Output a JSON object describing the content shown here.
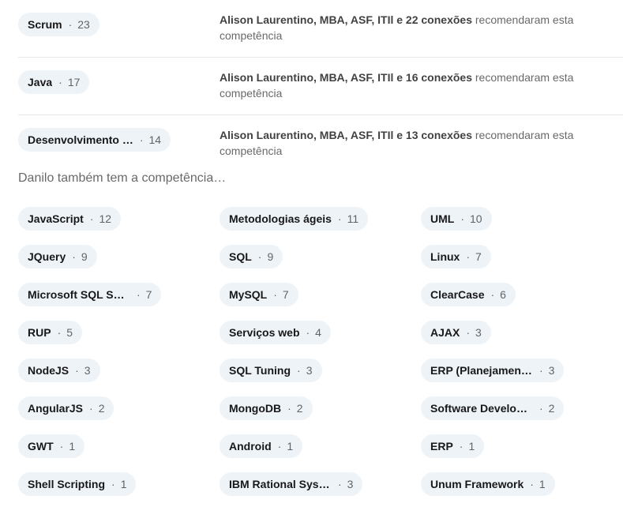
{
  "top_skills": [
    {
      "name": "Scrum",
      "count": "23",
      "endorsers": "Alison Laurentino, MBA, ASF, ITIl e 22 conexões",
      "suffix": "recomendaram esta competência"
    },
    {
      "name": "Java",
      "count": "17",
      "endorsers": "Alison Laurentino, MBA, ASF, ITIl e 16 conexões",
      "suffix": "recomendaram esta competência"
    },
    {
      "name": "Desenvolvimento …",
      "count": "14",
      "endorsers": "Alison Laurentino, MBA, ASF, ITIl e 13 conexões",
      "suffix": "recomendaram esta competência"
    }
  ],
  "other_section": {
    "title": "Danilo também tem a competência…"
  },
  "other_skills": [
    {
      "name": "JavaScript",
      "count": "12"
    },
    {
      "name": "Metodologias ágeis",
      "count": "11"
    },
    {
      "name": "UML",
      "count": "10"
    },
    {
      "name": "JQuery",
      "count": "9"
    },
    {
      "name": "SQL",
      "count": "9"
    },
    {
      "name": "Linux",
      "count": "7"
    },
    {
      "name": "Microsoft SQL Ser…",
      "count": "7"
    },
    {
      "name": "MySQL",
      "count": "7"
    },
    {
      "name": "ClearCase",
      "count": "6"
    },
    {
      "name": "RUP",
      "count": "5"
    },
    {
      "name": "Serviços web",
      "count": "4"
    },
    {
      "name": "AJAX",
      "count": "3"
    },
    {
      "name": "NodeJS",
      "count": "3"
    },
    {
      "name": "SQL Tuning",
      "count": "3"
    },
    {
      "name": "ERP (Planejament…",
      "count": "3"
    },
    {
      "name": "AngularJS",
      "count": "2"
    },
    {
      "name": "MongoDB",
      "count": "2"
    },
    {
      "name": "Software Develop…",
      "count": "2"
    },
    {
      "name": "GWT",
      "count": "1"
    },
    {
      "name": "Android",
      "count": "1"
    },
    {
      "name": "ERP",
      "count": "1"
    },
    {
      "name": "Shell Scripting",
      "count": "1"
    },
    {
      "name": "IBM Rational Syst…",
      "count": "3"
    },
    {
      "name": "Unum Framework",
      "count": "1"
    }
  ],
  "separator": "·",
  "colors": {
    "pill_bg": "#eef3f8",
    "divider": "#e6e9ec"
  }
}
